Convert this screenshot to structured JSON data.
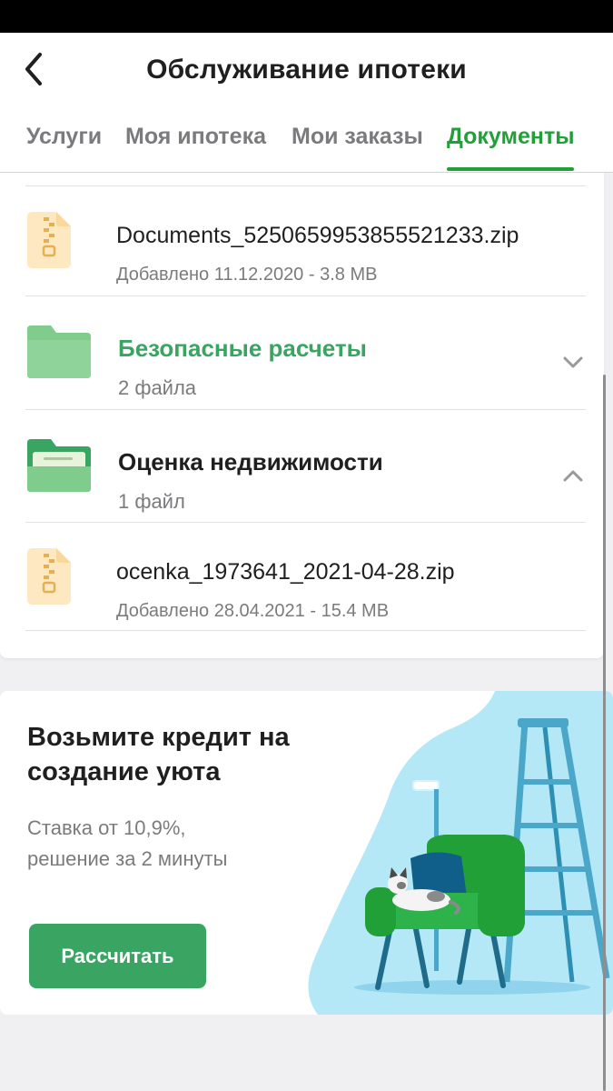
{
  "header": {
    "title": "Обслуживание ипотеки",
    "back_icon": "chevron-left-icon"
  },
  "tabs": [
    {
      "label": "Услуги",
      "active": false
    },
    {
      "label": "Моя ипотека",
      "active": false
    },
    {
      "label": "Мои заказы",
      "active": false
    },
    {
      "label": "Документы",
      "active": true
    }
  ],
  "documents": {
    "file1": {
      "name": "Documents_5250659953855521233.zip",
      "meta": "Добавлено 11.12.2020 - 3.8 MB",
      "icon": "zip-file-icon"
    },
    "folder1": {
      "name": "Безопасные расчеты",
      "count": "2 файла",
      "icon": "folder-icon",
      "expanded": false
    },
    "folder2": {
      "name": "Оценка недвижимости",
      "count": "1 файл",
      "icon": "folder-open-icon",
      "expanded": true
    },
    "file2": {
      "name": "ocenka_1973641_2021-04-28.zip",
      "meta": "Добавлено 28.04.2021 - 15.4 MB",
      "icon": "zip-file-icon"
    }
  },
  "promo": {
    "title_line1": "Возьмите кредит на",
    "title_line2": "создание уюта",
    "sub_line1": "Ставка от 10,9%,",
    "sub_line2": "решение за 2 минуты",
    "button": "Рассчитать",
    "illustration": "armchair-ladder-cat-illustration"
  },
  "colors": {
    "accent": "#21a038",
    "button": "#3aa563",
    "folder": "#7fcc8c",
    "zip_icon": "#fde8c2",
    "illustration_bg": "#b5e8f7"
  }
}
